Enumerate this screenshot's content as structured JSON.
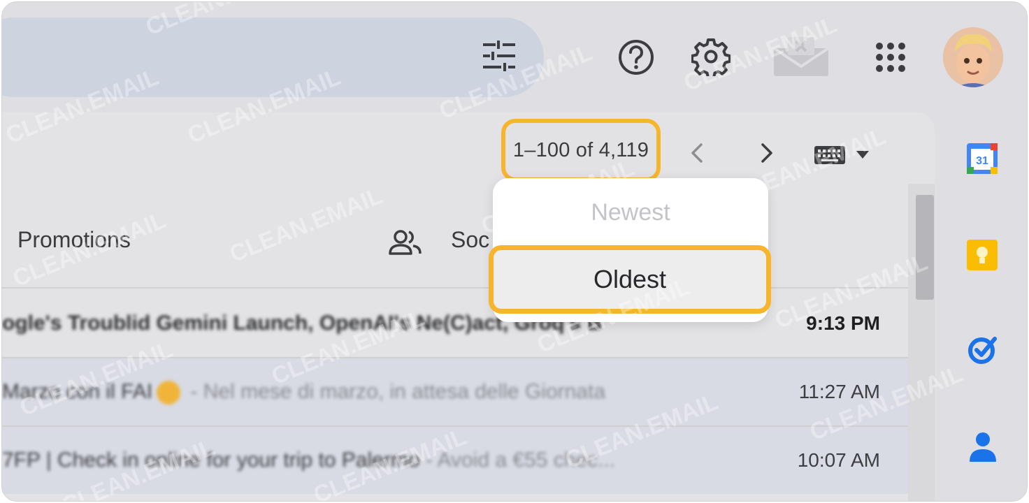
{
  "header": {
    "icons": [
      "tune-icon",
      "help-icon",
      "gear-icon",
      "mail-icon",
      "apps-icon"
    ],
    "avatar": "avatar"
  },
  "toolbar": {
    "page_range": "1–100 of 4,119",
    "icons": [
      "chevron-left-icon",
      "chevron-right-icon",
      "keyboard-icon",
      "caret-down-icon"
    ]
  },
  "tabs": {
    "promotions": "Promotions",
    "social": "Soc"
  },
  "sort_menu": {
    "options": [
      "Newest",
      "Oldest"
    ],
    "highlighted": "Oldest"
  },
  "emails": [
    {
      "subject": "ogle's Troublid Gemini Launch, OpenAI's Ne(C)act, Groq's B",
      "snippet": "",
      "time": "9:13 PM",
      "unread": true
    },
    {
      "subject": "Marzo con il FAI",
      "snippet": " - Nel mese di marzo, in attesa delle Giornata",
      "time": "11:27 AM",
      "unread": false
    },
    {
      "subject": "7FP | Check in online for your trip to Palermo",
      "snippet": " - Avoid a €55 chec...",
      "time": "10:07 AM",
      "unread": false
    }
  ],
  "side_panel": {
    "icons": [
      "calendar-icon",
      "keep-icon",
      "tasks-icon",
      "contacts-icon"
    ],
    "calendar_day": "31"
  },
  "watermark": "CLEAN.EMAIL",
  "colors": {
    "highlight": "#f7b52e",
    "calendar_blue": "#4285f4",
    "keep_yellow": "#fbbc04",
    "tasks_blue": "#1a73e8"
  }
}
